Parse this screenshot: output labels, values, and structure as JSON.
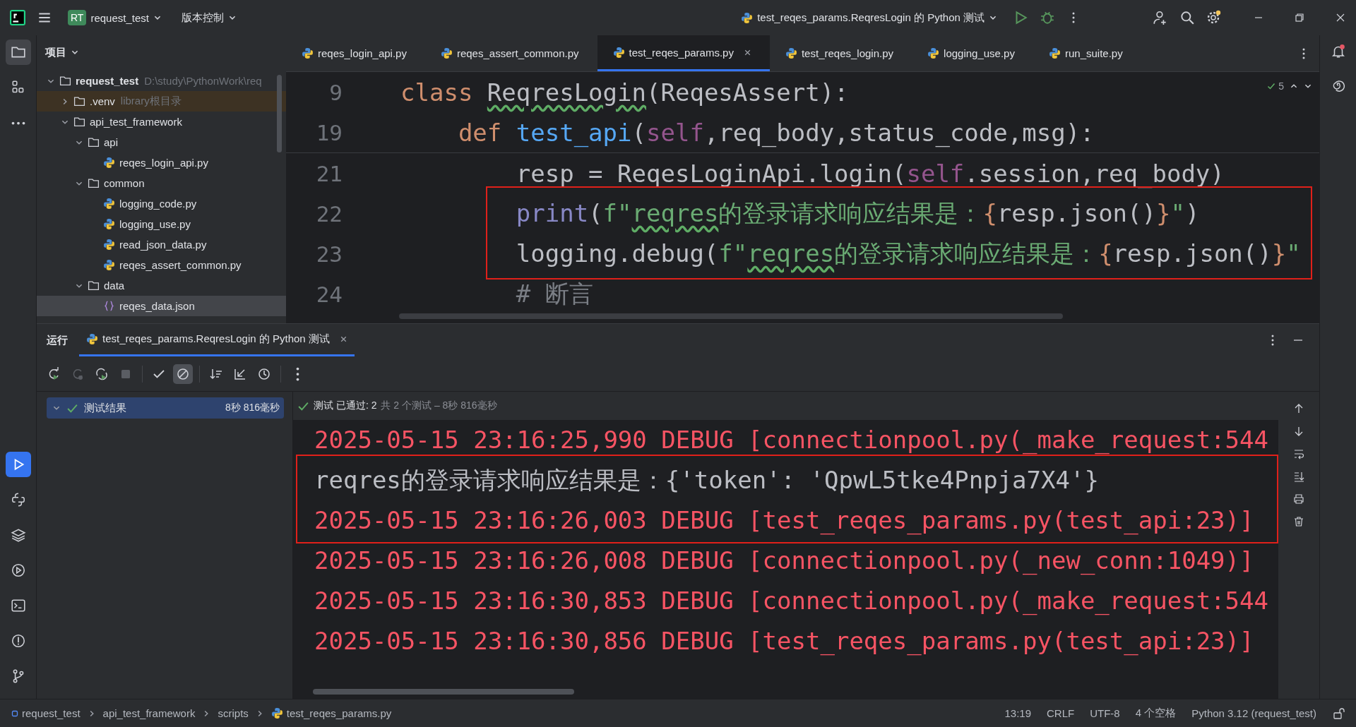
{
  "title_bar": {
    "project_badge": "RT",
    "project": "request_test",
    "vcs": "版本控制",
    "run_config": "test_reqes_params.ReqresLogin 的 Python 测试"
  },
  "tool_strip": [
    {
      "kind": "project",
      "selected": true
    },
    {
      "kind": "structure",
      "selected": false
    },
    {
      "kind": "more",
      "selected": false
    },
    {
      "kind": "run",
      "selected": true
    },
    {
      "kind": "python-console",
      "selected": false
    },
    {
      "kind": "layers",
      "selected": false
    },
    {
      "kind": "services",
      "selected": false
    },
    {
      "kind": "terminal",
      "selected": false
    },
    {
      "kind": "problems",
      "selected": false
    },
    {
      "kind": "git",
      "selected": false
    }
  ],
  "project_panel": {
    "title": "项目",
    "tree": [
      {
        "kind": "folder",
        "label": "request_test",
        "hint": "D:\\study\\PythonWork\\req",
        "bold": true,
        "expanded": true,
        "selected": false,
        "library": false,
        "children": [
          {
            "kind": "folder",
            "label": ".venv",
            "hint": "library根目录",
            "bold": false,
            "expanded": false,
            "selected": false,
            "library": true
          },
          {
            "kind": "folder",
            "label": "api_test_framework",
            "bold": false,
            "expanded": true,
            "selected": false,
            "library": false,
            "children": [
              {
                "kind": "folder",
                "label": "api",
                "bold": false,
                "expanded": true,
                "selected": false,
                "library": false,
                "children": [
                  {
                    "kind": "python",
                    "label": "reqes_login_api.py",
                    "bold": false,
                    "selected": false,
                    "library": false
                  }
                ]
              },
              {
                "kind": "folder",
                "label": "common",
                "bold": false,
                "expanded": true,
                "selected": false,
                "library": false,
                "children": [
                  {
                    "kind": "python",
                    "label": "logging_code.py",
                    "bold": false,
                    "selected": false,
                    "library": false
                  },
                  {
                    "kind": "python",
                    "label": "logging_use.py",
                    "bold": false,
                    "selected": false,
                    "library": false
                  },
                  {
                    "kind": "python",
                    "label": "read_json_data.py",
                    "bold": false,
                    "selected": false,
                    "library": false
                  },
                  {
                    "kind": "python",
                    "label": "reqes_assert_common.py",
                    "bold": false,
                    "selected": false,
                    "library": false
                  }
                ]
              },
              {
                "kind": "folder",
                "label": "data",
                "bold": false,
                "expanded": true,
                "selected": false,
                "library": false,
                "children": [
                  {
                    "kind": "json",
                    "label": "reqes_data.json",
                    "bold": false,
                    "selected": true,
                    "library": false
                  }
                ]
              }
            ]
          }
        ]
      }
    ]
  },
  "editor": {
    "tabs": [
      {
        "label": "reqes_login_api.py",
        "selected": false
      },
      {
        "label": "reqes_assert_common.py",
        "selected": false
      },
      {
        "label": "test_reqes_params.py",
        "selected": true
      },
      {
        "label": "test_reqes_login.py",
        "selected": false
      },
      {
        "label": "logging_use.py",
        "selected": false
      },
      {
        "label": "run_suite.py",
        "selected": false
      }
    ],
    "inspection_count": "5",
    "sticky_lines": [
      {
        "number": "9",
        "tokens": [
          {
            "kind": "keyword",
            "text": "class "
          },
          {
            "kind": "name-typo",
            "text": "ReqresLogin"
          },
          {
            "kind": "plain",
            "text": "(ReqesAssert):"
          }
        ]
      },
      {
        "number": "19",
        "tokens": [
          {
            "kind": "keyword",
            "text": "    def "
          },
          {
            "kind": "func",
            "text": "test_api"
          },
          {
            "kind": "plain",
            "text": "("
          },
          {
            "kind": "self",
            "text": "self"
          },
          {
            "kind": "plain",
            "text": ",req_body,status_code,msg):"
          }
        ]
      }
    ],
    "lines": [
      {
        "number": "21",
        "boxed": false,
        "tokens": [
          {
            "kind": "plain",
            "text": "        resp = ReqesLoginApi.login("
          },
          {
            "kind": "self",
            "text": "self"
          },
          {
            "kind": "plain",
            "text": ".session,req_body)"
          }
        ]
      },
      {
        "number": "22",
        "boxed": true,
        "tokens": [
          {
            "kind": "builtin",
            "text": "        print"
          },
          {
            "kind": "plain",
            "text": "("
          },
          {
            "kind": "string",
            "text": "f\""
          },
          {
            "kind": "string-typo",
            "text": "reqres"
          },
          {
            "kind": "string",
            "text": "的登录请求响应结果是："
          },
          {
            "kind": "brace",
            "text": "{"
          },
          {
            "kind": "plain",
            "text": "resp.json()"
          },
          {
            "kind": "brace",
            "text": "}"
          },
          {
            "kind": "string",
            "text": "\""
          },
          {
            "kind": "plain",
            "text": ")"
          }
        ]
      },
      {
        "number": "23",
        "boxed": true,
        "tokens": [
          {
            "kind": "plain",
            "text": "        logging.debug("
          },
          {
            "kind": "string",
            "text": "f\""
          },
          {
            "kind": "string-typo",
            "text": "reqres"
          },
          {
            "kind": "string",
            "text": "的登录请求响应结果是："
          },
          {
            "kind": "brace",
            "text": "{"
          },
          {
            "kind": "plain",
            "text": "resp.json()"
          },
          {
            "kind": "brace",
            "text": "}"
          },
          {
            "kind": "string",
            "text": "\""
          }
        ]
      },
      {
        "number": "24",
        "boxed": false,
        "tokens": [
          {
            "kind": "comment",
            "text": "        # 断言"
          }
        ]
      }
    ]
  },
  "run_panel": {
    "title": "运行",
    "tabs": [
      {
        "label": "test_reqes_params.ReqresLogin 的 Python 测试",
        "selected": true
      }
    ],
    "toolbar": [
      {
        "kind": "rerun",
        "disabled": false,
        "toggled": false
      },
      {
        "kind": "rerun-failed",
        "disabled": true,
        "toggled": false
      },
      {
        "kind": "toggle-auto",
        "disabled": false,
        "toggled": false
      },
      {
        "kind": "stop",
        "disabled": true,
        "toggled": false
      },
      {
        "kind": "show-passed",
        "disabled": false,
        "toggled": false
      },
      {
        "kind": "show-ignored",
        "disabled": false,
        "toggled": true
      },
      {
        "kind": "sort",
        "disabled": false,
        "toggled": false
      },
      {
        "kind": "collapse",
        "disabled": false,
        "toggled": false
      },
      {
        "kind": "history",
        "disabled": false,
        "toggled": false
      },
      {
        "kind": "more",
        "disabled": false,
        "toggled": false
      }
    ],
    "results": [
      {
        "label": "测试结果",
        "time": "8秒 816毫秒",
        "selected": true,
        "expanded": true
      }
    ],
    "summary": {
      "status": "测试 已通过: 2",
      "detail": "共 2 个测试 – 8秒 816毫秒"
    },
    "console": [
      {
        "kind": "log",
        "boxed": false,
        "text": "2025-05-15 23:16:25,990 DEBUG [connectionpool.py(_make_request:544"
      },
      {
        "kind": "stdout",
        "boxed": true,
        "text": "reqres的登录请求响应结果是：{'token': 'QpwL5tke4Pnpja7X4'}"
      },
      {
        "kind": "log",
        "boxed": true,
        "text": "2025-05-15 23:16:26,003 DEBUG [test_reqes_params.py(test_api:23)]"
      },
      {
        "kind": "log",
        "boxed": false,
        "text": "2025-05-15 23:16:26,008 DEBUG [connectionpool.py(_new_conn:1049)]"
      },
      {
        "kind": "log",
        "boxed": false,
        "text": "2025-05-15 23:16:30,853 DEBUG [connectionpool.py(_make_request:544"
      },
      {
        "kind": "log",
        "boxed": false,
        "text": "2025-05-15 23:16:30,856 DEBUG [test_reqes_params.py(test_api:23)]"
      }
    ]
  },
  "status_bar": {
    "breadcrumbs": [
      {
        "kind": "module",
        "label": "request_test"
      },
      {
        "kind": "folder",
        "label": "api_test_framework"
      },
      {
        "kind": "folder",
        "label": "scripts"
      },
      {
        "kind": "python",
        "label": "test_reqes_params.py"
      }
    ],
    "items": [
      "13:19",
      "CRLF",
      "UTF-8",
      "4 个空格",
      "Python 3.12 (request_test)"
    ]
  }
}
